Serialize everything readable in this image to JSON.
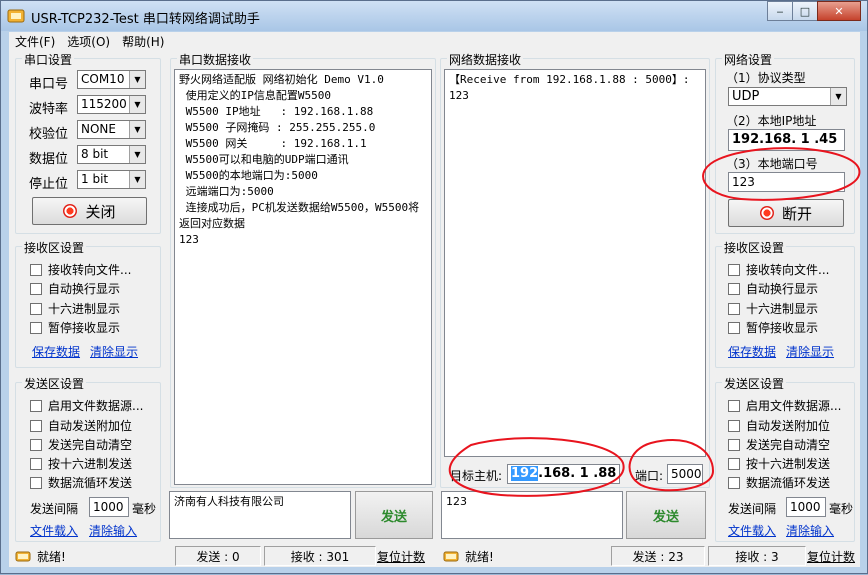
{
  "window": {
    "title": "USR-TCP232-Test 串口转网络调试助手",
    "minimize_glyph": "‒",
    "maximize_glyph": "□",
    "close_glyph": "✕"
  },
  "menu": [
    "文件(F)",
    "选项(O)",
    "帮助(H)"
  ],
  "serial_settings": {
    "title": "串口设置",
    "port_label": "串口号",
    "port_value": "COM10",
    "baud_label": "波特率",
    "baud_value": "115200",
    "parity_label": "校验位",
    "parity_value": "NONE",
    "databits_label": "数据位",
    "databits_value": "8 bit",
    "stopbits_label": "停止位",
    "stopbits_value": "1 bit",
    "toggle_label": "关闭"
  },
  "left_recv": {
    "title": "接收区设置",
    "options": [
      "接收转向文件...",
      "自动换行显示",
      "十六进制显示",
      "暂停接收显示"
    ],
    "save_link": "保存数据",
    "clear_link": "清除显示"
  },
  "left_send": {
    "title": "发送区设置",
    "options": [
      "启用文件数据源...",
      "自动发送附加位",
      "发送完自动清空",
      "按十六进制发送",
      "数据流循环发送"
    ],
    "interval_label": "发送间隔",
    "interval_value": "1000",
    "interval_unit": "毫秒",
    "load_link": "文件载入",
    "clear_link": "清除输入"
  },
  "serial_recv": {
    "title": "串口数据接收",
    "lines": [
      "野火网络适配版 网络初始化 Demo V1.0",
      " 使用定义的IP信息配置W5500",
      " W5500 IP地址   : 192.168.1.88",
      " W5500 子网掩码 : 255.255.255.0",
      " W5500 网关     : 192.168.1.1",
      " W5500可以和电脑的UDP端口通讯",
      " W5500的本地端口为:5000",
      " 远端端口为:5000",
      " 连接成功后，PC机发送数据给W5500，W5500将",
      "返回对应数据",
      "123"
    ]
  },
  "serial_send": {
    "text": "济南有人科技有限公司",
    "button": "发送"
  },
  "net_recv": {
    "title": "网络数据接收",
    "lines": [
      "【Receive from 192.168.1.88 : 5000】:",
      "123"
    ]
  },
  "net_target": {
    "host_label": "目标主机:",
    "host_selected": "192",
    "host_rest": ".168. 1 .88",
    "port_label": "端口:",
    "port_value": "5000"
  },
  "net_send": {
    "text": "123",
    "button": "发送"
  },
  "net_settings": {
    "title": "网络设置",
    "protocol_label": "（1）协议类型",
    "protocol_value": "UDP",
    "ip_label": "（2）本地IP地址",
    "ip_value": "192.168. 1 .45",
    "port_label": "（3）本地端口号",
    "port_value": "123",
    "toggle_label": "断开"
  },
  "right_recv": {
    "title": "接收区设置",
    "options": [
      "接收转向文件...",
      "自动换行显示",
      "十六进制显示",
      "暂停接收显示"
    ],
    "save_link": "保存数据",
    "clear_link": "清除显示"
  },
  "right_send": {
    "title": "发送区设置",
    "options": [
      "启用文件数据源...",
      "自动发送附加位",
      "发送完自动清空",
      "按十六进制发送",
      "数据流循环发送"
    ],
    "interval_label": "发送间隔",
    "interval_value": "1000",
    "interval_unit": "毫秒",
    "load_link": "文件载入",
    "clear_link": "清除输入"
  },
  "status": {
    "left_ready": "就绪!",
    "left_sent": "发送 : 0",
    "left_recv": "接收 : 301",
    "left_reset": "复位计数",
    "right_ready": "就绪!",
    "right_sent": "发送 : 23",
    "right_recv": "接收 : 3",
    "right_reset": "复位计数"
  },
  "colors": {
    "annotation": "#e8141e",
    "link": "#0033cc",
    "send_text": "#2d8a2d",
    "selection": "#3399ff"
  }
}
